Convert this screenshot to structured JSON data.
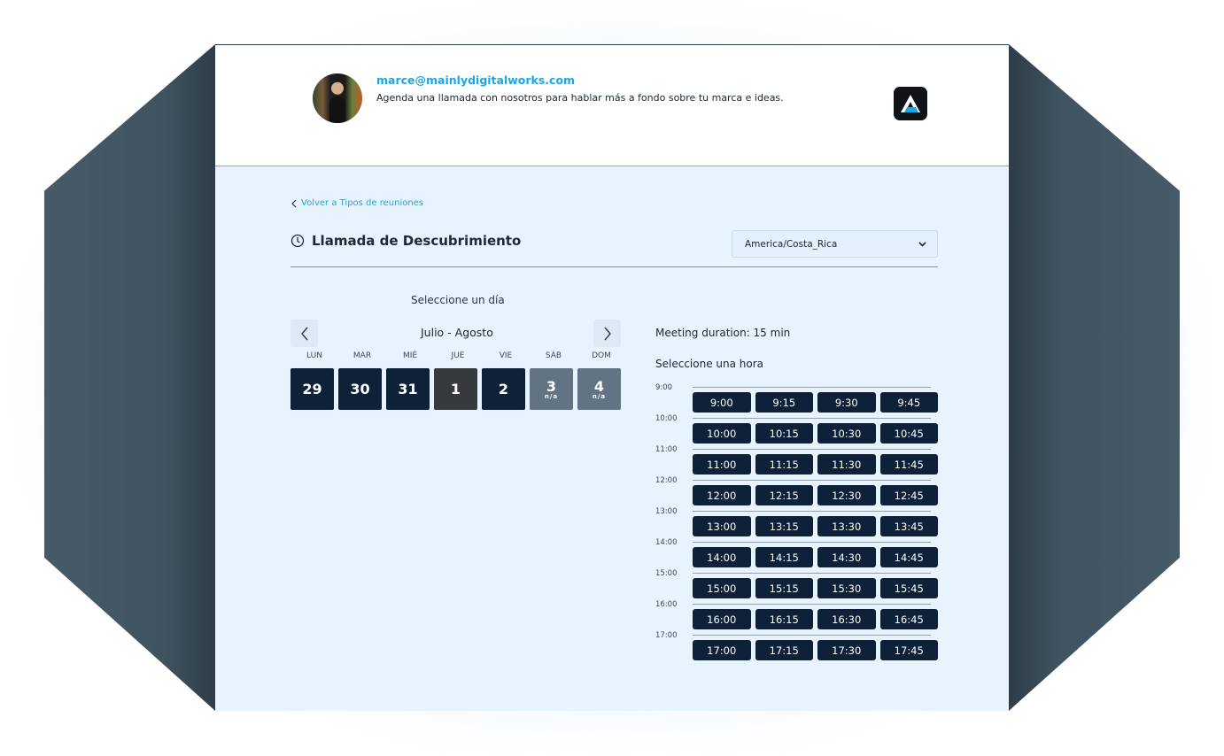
{
  "header": {
    "email": "marce@mainlydigitalworks.com",
    "description": "Agenda una llamada con nosotros para hablar más a fondo sobre tu marca e ideas."
  },
  "back_link": "Volver a Tipos de reuniones",
  "title": "Llamada de Descubrimiento",
  "timezone": "America/Costa_Rica",
  "calendar": {
    "heading": "Seleccione un día",
    "month_label": "Julio - Agosto",
    "weekdays": [
      "LUN",
      "MAR",
      "MIÉ",
      "JUE",
      "VIE",
      "SÁB",
      "DOM"
    ],
    "days": [
      {
        "number": "29",
        "state": "available"
      },
      {
        "number": "30",
        "state": "available"
      },
      {
        "number": "31",
        "state": "available"
      },
      {
        "number": "1",
        "state": "today"
      },
      {
        "number": "2",
        "state": "available"
      },
      {
        "number": "3",
        "state": "unavailable",
        "note": "n/a"
      },
      {
        "number": "4",
        "state": "unavailable",
        "note": "n/a"
      }
    ]
  },
  "times": {
    "duration": "Meeting duration: 15 min",
    "heading": "Seleccione una hora",
    "hours": [
      {
        "label": "9:00",
        "slots": [
          "9:00",
          "9:15",
          "9:30",
          "9:45"
        ]
      },
      {
        "label": "10:00",
        "slots": [
          "10:00",
          "10:15",
          "10:30",
          "10:45"
        ]
      },
      {
        "label": "11:00",
        "slots": [
          "11:00",
          "11:15",
          "11:30",
          "11:45"
        ]
      },
      {
        "label": "12:00",
        "slots": [
          "12:00",
          "12:15",
          "12:30",
          "12:45"
        ]
      },
      {
        "label": "13:00",
        "slots": [
          "13:00",
          "13:15",
          "13:30",
          "13:45"
        ]
      },
      {
        "label": "14:00",
        "slots": [
          "14:00",
          "14:15",
          "14:30",
          "14:45"
        ]
      },
      {
        "label": "15:00",
        "slots": [
          "15:00",
          "15:15",
          "15:30",
          "15:45"
        ]
      },
      {
        "label": "16:00",
        "slots": [
          "16:00",
          "16:15",
          "16:30",
          "16:45"
        ]
      },
      {
        "label": "17:00",
        "slots": [
          "17:00",
          "17:15",
          "17:30",
          "17:45"
        ]
      }
    ]
  },
  "icons": {
    "back": "chevron-left-icon",
    "clock": "clock-icon",
    "dropdown": "chevron-down-icon",
    "prev": "chevron-left-icon",
    "next": "chevron-right-icon",
    "logo": "brand-logo"
  },
  "colors": {
    "accent": "#1ba7e6",
    "button": "#0e2138",
    "today": "#363a3e",
    "unavailable": "#627384",
    "panel_bg": "#e7f4fd"
  }
}
